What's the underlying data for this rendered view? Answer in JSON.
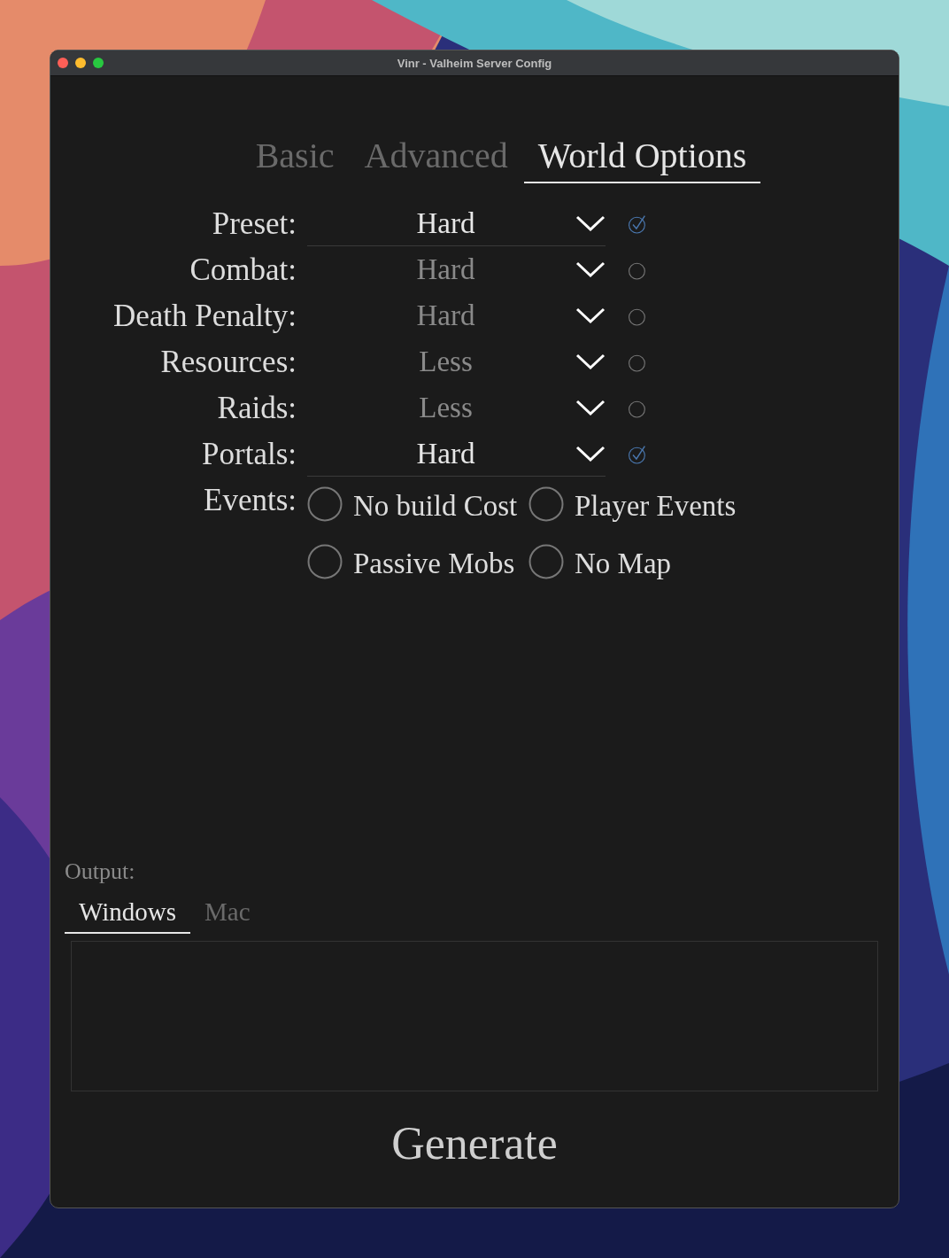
{
  "window": {
    "title": "Vinr - Valheim Server Config"
  },
  "tabs": [
    {
      "label": "Basic",
      "selected": false
    },
    {
      "label": "Advanced",
      "selected": false
    },
    {
      "label": "World Options",
      "selected": true
    }
  ],
  "settings": [
    {
      "label": "Preset:",
      "value": "Hard",
      "checked": true
    },
    {
      "label": "Combat:",
      "value": "Hard",
      "checked": false
    },
    {
      "label": "Death Penalty:",
      "value": "Hard",
      "checked": false
    },
    {
      "label": "Resources:",
      "value": "Less",
      "checked": false
    },
    {
      "label": "Raids:",
      "value": "Less",
      "checked": false
    },
    {
      "label": "Portals:",
      "value": "Hard",
      "checked": true
    }
  ],
  "events": {
    "label": "Events:",
    "options": [
      {
        "label": "No build Cost",
        "checked": false
      },
      {
        "label": "Player Events",
        "checked": false
      },
      {
        "label": "Passive Mobs",
        "checked": false
      },
      {
        "label": "No Map",
        "checked": false
      }
    ]
  },
  "output": {
    "label": "Output:",
    "tabs": [
      {
        "label": "Windows",
        "selected": true
      },
      {
        "label": "Mac",
        "selected": false
      }
    ]
  },
  "generate_button": "Generate"
}
